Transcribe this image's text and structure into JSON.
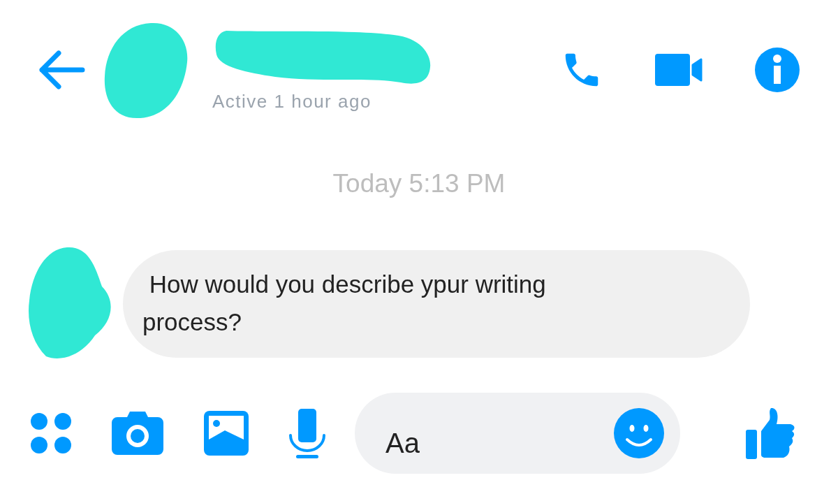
{
  "header": {
    "status": "Active 1 hour ago",
    "actions": [
      {
        "kind": "call"
      },
      {
        "kind": "video"
      },
      {
        "kind": "info"
      }
    ]
  },
  "thread": {
    "timestamp": "Today 5:13 PM",
    "messages": [
      {
        "text": " How would you describe ypur writing\nprocess?"
      }
    ]
  },
  "composer": {
    "tools": [
      {
        "kind": "apps"
      },
      {
        "kind": "camera"
      },
      {
        "kind": "gallery"
      },
      {
        "kind": "mic"
      }
    ],
    "placeholder": "Aa",
    "send": {
      "kind": "like"
    }
  }
}
